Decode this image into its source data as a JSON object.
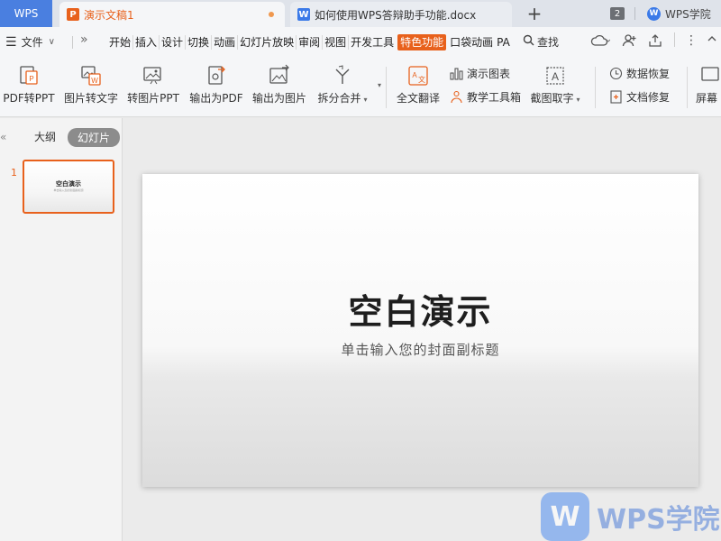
{
  "tabbar": {
    "home_label": "WPS",
    "active_tab": {
      "label": "演示文稿1",
      "icon": "presentation-doc-icon"
    },
    "inactive_tab": {
      "label": "如何使用WPS答辩助手功能.docx",
      "icon": "word-doc-icon"
    },
    "new_tab_symbol": "+",
    "window_count": "2",
    "academy_label": "WPS学院"
  },
  "menubar": {
    "file_label": "文件",
    "more_symbol": "»",
    "tabs": [
      "开始",
      "插入",
      "设计",
      "切换",
      "动画",
      "幻灯片放映",
      "审阅",
      "视图",
      "开发工具",
      "特色功能",
      "口袋动画",
      "PA"
    ],
    "active_tab_index": 9,
    "search_label": "查找"
  },
  "toolbar": {
    "pdf_to_ppt": "PDF转PPT",
    "img_to_text": "图片转文字",
    "img_to_ppt": "转图片PPT",
    "export_pdf": "输出为PDF",
    "export_img": "输出为图片",
    "split_merge": "拆分合并",
    "translate": "全文翻译",
    "demo_chart": "演示图表",
    "teach_tools": "教学工具箱",
    "screenshot_ocr": "截图取字",
    "data_recovery": "数据恢复",
    "doc_repair": "文档修复",
    "screen": "屏幕"
  },
  "leftpanel": {
    "outline_label": "大纲",
    "slides_label": "幻灯片",
    "slide_number": "1",
    "thumb_title": "空白演示",
    "thumb_subtitle": "单击输入您的封面副标题"
  },
  "slide": {
    "title": "空白演示",
    "subtitle": "单击输入您的封面副标题"
  },
  "watermark": {
    "logo_letter": "W",
    "text": "WPS学院"
  },
  "colors": {
    "accent": "#e8611c",
    "home_tab": "#4a7fe0",
    "word_blue": "#3b7ae8"
  }
}
